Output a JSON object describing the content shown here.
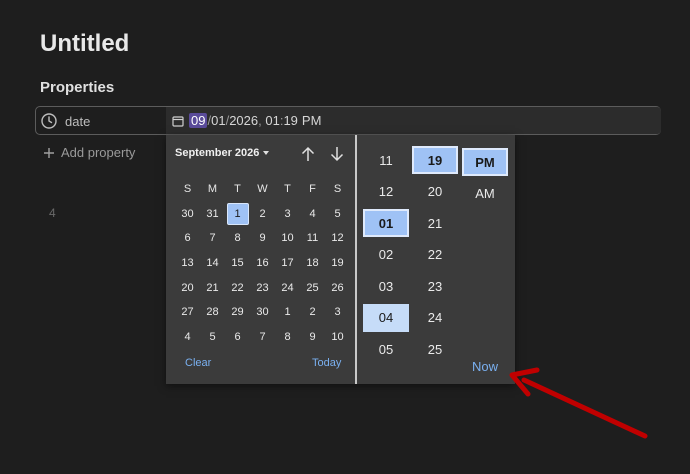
{
  "page": {
    "title": "Untitled"
  },
  "properties": {
    "heading": "Properties",
    "date_key": "date",
    "value": {
      "day": "09",
      "sep1": "/",
      "month": "01",
      "sep2": "/",
      "year": "2026",
      "sep3": ", ",
      "hour": "01",
      "sep4": ":",
      "minute": "19",
      "ampm": "PM"
    },
    "add_label": "Add property"
  },
  "editor": {
    "line_number": "4"
  },
  "picker": {
    "month_label": "September 2026",
    "weekdays": [
      "S",
      "M",
      "T",
      "W",
      "T",
      "F",
      "S"
    ],
    "weeks": [
      [
        "30",
        "31",
        "1",
        "2",
        "3",
        "4",
        "5"
      ],
      [
        "6",
        "7",
        "8",
        "9",
        "10",
        "11",
        "12"
      ],
      [
        "13",
        "14",
        "15",
        "16",
        "17",
        "18",
        "19"
      ],
      [
        "20",
        "21",
        "22",
        "23",
        "24",
        "25",
        "26"
      ],
      [
        "27",
        "28",
        "29",
        "30",
        "1",
        "2",
        "3"
      ],
      [
        "4",
        "5",
        "6",
        "7",
        "8",
        "9",
        "10"
      ]
    ],
    "selected_day": "1",
    "clear_label": "Clear",
    "today_label": "Today",
    "hours": [
      "11",
      "12",
      "01",
      "02",
      "03",
      "04",
      "05"
    ],
    "selected_hour": "01",
    "hover_hour": "04",
    "minutes": [
      "19",
      "20",
      "21",
      "22",
      "23",
      "24",
      "25"
    ],
    "selected_minute": "19",
    "periods": [
      "PM",
      "AM"
    ],
    "selected_period": "PM",
    "now_label": "Now"
  },
  "colors": {
    "selection": "#9fc2f5",
    "link": "#7ab0f0",
    "annotation_arrow": "#cc0000"
  }
}
